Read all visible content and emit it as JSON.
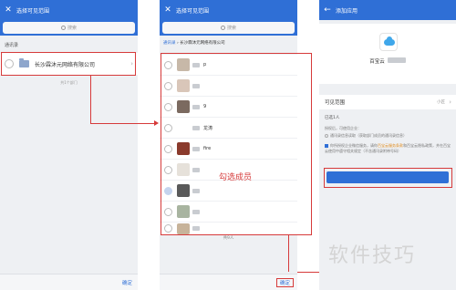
{
  "panel1": {
    "title": "选择可见范围",
    "search_placeholder": "搜索",
    "section_title": "通讯录",
    "org_name": "长沙霖沐元网络有限公司",
    "org_count": "共1个部门",
    "confirm_label": "确定"
  },
  "panel2": {
    "title": "选择可见范围",
    "search_placeholder": "搜索",
    "breadcrumb_root": "通讯录",
    "breadcrumb_current": "长沙霖沐元网络有限公司",
    "members": [
      {
        "name": "p",
        "checked": false
      },
      {
        "name": "",
        "checked": false
      },
      {
        "name": "9",
        "checked": false
      },
      {
        "name": "龙涛",
        "checked": false
      },
      {
        "name": "fire",
        "checked": false
      },
      {
        "name": "",
        "checked": false
      },
      {
        "name": "",
        "checked": true
      },
      {
        "name": "",
        "checked": false
      },
      {
        "name": "",
        "checked": false
      }
    ],
    "annotation": "勾选成员",
    "member_count": "共9人",
    "confirm_label": "确定"
  },
  "panel3": {
    "title": "添加应用",
    "app_name": "百宝云",
    "visible_label": "可见范围",
    "visible_value": "小匠",
    "selected_count": "已选1人",
    "permission_title": "授权后，可使用企业：",
    "permission_item": "通讯录信息读取（获取部门成员的通讯录信息）",
    "agree_text_1": "你所授权企业微信服务，请你",
    "agree_link": "百宝云服务条款",
    "agree_text_2": "和百宝云隐私政策，并在百宝云使用中遵守相关规定（不含通讯录附带号码）"
  },
  "watermark": "软件技巧",
  "colors": {
    "header_blue": "#2f6fd6",
    "annotation_red": "#d63a3a",
    "link_orange": "#e08a1a"
  }
}
